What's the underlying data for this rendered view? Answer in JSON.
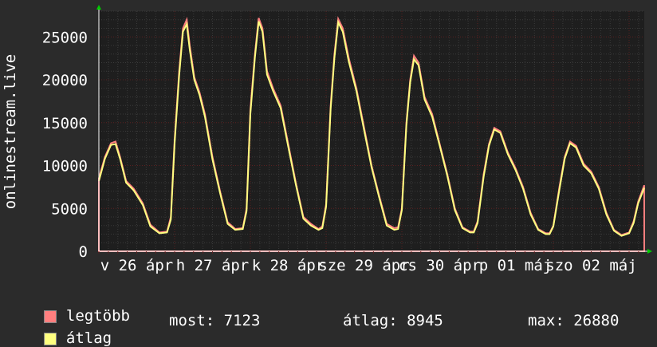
{
  "chart_data": {
    "type": "area",
    "ylabel": "onlinestream.live",
    "ylim": [
      0,
      28000
    ],
    "yticks": [
      0,
      5000,
      10000,
      15000,
      20000,
      25000
    ],
    "xlabels": [
      "v 26 ápr",
      "h 27 ápr",
      "k 28 ápr",
      "sze 29 ápr",
      "cs 30 ápr",
      "p 01 máj",
      "szo 02 máj"
    ],
    "grid": true,
    "x_domain": [
      0,
      7.2
    ],
    "series": [
      {
        "name": "legtöbb",
        "color": "#ff7f7f",
        "x": [
          0,
          0.08,
          0.16,
          0.22,
          0.28,
          0.36,
          0.46,
          0.58,
          0.68,
          0.8,
          0.9,
          0.95,
          1.0,
          1.06,
          1.11,
          1.16,
          1.2,
          1.26,
          1.33,
          1.4,
          1.5,
          1.6,
          1.7,
          1.8,
          1.9,
          1.95,
          2.0,
          2.06,
          2.11,
          2.16,
          2.22,
          2.3,
          2.4,
          2.5,
          2.6,
          2.7,
          2.8,
          2.9,
          2.95,
          3.0,
          3.06,
          3.11,
          3.16,
          3.22,
          3.3,
          3.4,
          3.5,
          3.6,
          3.7,
          3.8,
          3.9,
          3.95,
          4.0,
          4.06,
          4.11,
          4.16,
          4.22,
          4.3,
          4.4,
          4.5,
          4.6,
          4.7,
          4.8,
          4.9,
          4.95,
          5.0,
          5.08,
          5.15,
          5.22,
          5.3,
          5.4,
          5.5,
          5.6,
          5.7,
          5.8,
          5.9,
          5.95,
          6.0,
          6.08,
          6.15,
          6.22,
          6.3,
          6.4,
          6.5,
          6.6,
          6.7,
          6.8,
          6.9,
          7.0,
          7.06,
          7.12,
          7.2
        ],
        "y": [
          8500,
          11000,
          12600,
          12800,
          11000,
          8200,
          7300,
          5600,
          3100,
          2200,
          2300,
          4000,
          13000,
          21000,
          26000,
          27000,
          24000,
          20300,
          18500,
          16000,
          11000,
          7000,
          3400,
          2600,
          2700,
          5000,
          16500,
          23000,
          27200,
          26000,
          21000,
          19000,
          17000,
          12500,
          8000,
          4000,
          3200,
          2600,
          2900,
          5500,
          17000,
          23000,
          27100,
          26000,
          22500,
          19000,
          14500,
          10000,
          6500,
          3200,
          2700,
          2800,
          5000,
          15000,
          20000,
          22800,
          22000,
          18000,
          16000,
          12500,
          9000,
          5000,
          2800,
          2300,
          2300,
          3500,
          9000,
          12500,
          14400,
          14000,
          11500,
          9700,
          7500,
          4500,
          2600,
          2100,
          2100,
          3000,
          7500,
          11000,
          12800,
          12300,
          10200,
          9300,
          7500,
          4500,
          2500,
          1900,
          2200,
          3500,
          5800,
          7700
        ],
        "note": ""
      },
      {
        "name": "átlag",
        "color": "#ffff80",
        "x": [
          0,
          0.08,
          0.16,
          0.22,
          0.28,
          0.36,
          0.46,
          0.58,
          0.68,
          0.8,
          0.9,
          0.95,
          1.0,
          1.06,
          1.11,
          1.16,
          1.2,
          1.26,
          1.33,
          1.4,
          1.5,
          1.6,
          1.7,
          1.8,
          1.9,
          1.95,
          2.0,
          2.06,
          2.11,
          2.16,
          2.22,
          2.3,
          2.4,
          2.5,
          2.6,
          2.7,
          2.8,
          2.9,
          2.95,
          3.0,
          3.06,
          3.11,
          3.16,
          3.22,
          3.3,
          3.4,
          3.5,
          3.6,
          3.7,
          3.8,
          3.9,
          3.95,
          4.0,
          4.06,
          4.11,
          4.16,
          4.22,
          4.3,
          4.4,
          4.5,
          4.6,
          4.7,
          4.8,
          4.9,
          4.95,
          5.0,
          5.08,
          5.15,
          5.22,
          5.3,
          5.4,
          5.5,
          5.6,
          5.7,
          5.8,
          5.9,
          5.95,
          6.0,
          6.08,
          6.15,
          6.22,
          6.3,
          6.4,
          6.5,
          6.6,
          6.7,
          6.8,
          6.9,
          7.0,
          7.06,
          7.12,
          7.2
        ],
        "y": [
          8200,
          10800,
          12400,
          12500,
          10800,
          8000,
          7100,
          5400,
          2900,
          2100,
          2200,
          3700,
          12600,
          20500,
          25600,
          26500,
          23500,
          20000,
          18200,
          15700,
          10700,
          6800,
          3200,
          2500,
          2600,
          4700,
          16000,
          22600,
          26800,
          25600,
          20600,
          18700,
          16700,
          12200,
          7800,
          3800,
          3000,
          2500,
          2700,
          5200,
          16600,
          22600,
          26700,
          25600,
          22100,
          18700,
          14200,
          9800,
          6300,
          3000,
          2500,
          2600,
          4800,
          14700,
          19700,
          22400,
          21700,
          17700,
          15700,
          12300,
          8800,
          4800,
          2700,
          2200,
          2200,
          3300,
          8700,
          12300,
          14200,
          13800,
          11300,
          9500,
          7300,
          4300,
          2500,
          2000,
          2000,
          2900,
          7200,
          10800,
          12600,
          12100,
          10000,
          9100,
          7300,
          4300,
          2400,
          1800,
          2100,
          3300,
          5600,
          7400
        ]
      }
    ]
  },
  "legend": {
    "max_label": "legtöbb",
    "avg_label": "átlag"
  },
  "stats": {
    "current": "most: 7123",
    "average": "átlag: 8945",
    "max": "max: 26880"
  },
  "colors": {
    "background": "#2b2b2b",
    "plot_background": "#1e1e1e",
    "grid_minor": "#3a3a3a",
    "grid_major": "#5a2020",
    "axis": "#ffffff",
    "arrow": "#00cc00",
    "max_color": "#ff7f7f",
    "avg_color": "#ffff80"
  }
}
